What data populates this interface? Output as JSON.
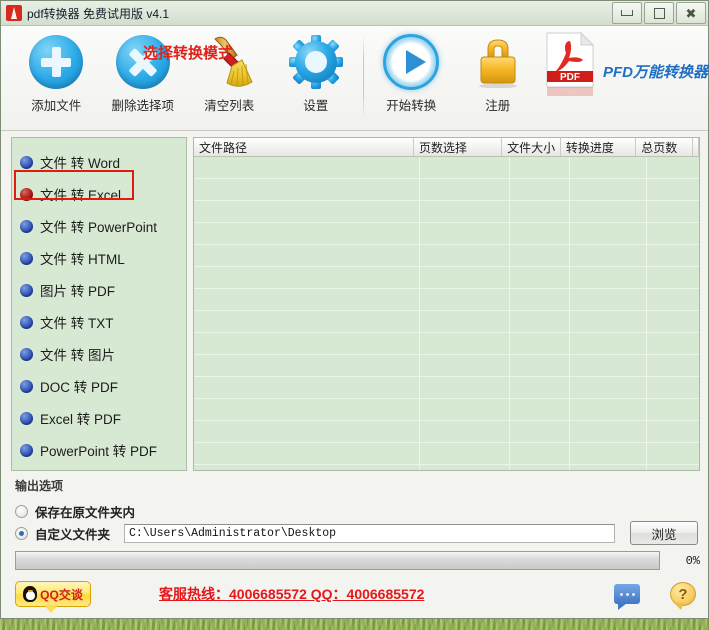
{
  "window": {
    "title": "pdf转换器 免费试用版 v4.1",
    "app_icon": "pdf-app-icon",
    "minimize": "minimize-icon",
    "maximize": "maximize-icon",
    "close": "close-icon"
  },
  "toolbar": {
    "buttons": [
      {
        "label": "添加文件",
        "icon": "add-file-icon"
      },
      {
        "label": "删除选择项",
        "icon": "delete-selection-icon"
      },
      {
        "label": "清空列表",
        "icon": "broom-clear-icon"
      },
      {
        "label": "设置",
        "icon": "gear-settings-icon"
      },
      {
        "label": "开始转换",
        "icon": "play-start-icon"
      },
      {
        "label": "注册",
        "icon": "lock-register-icon"
      }
    ],
    "brand": {
      "icon": "pdf-document-icon",
      "icon_label": "PDF",
      "text": "PFD万能转换器"
    }
  },
  "modes": {
    "items": [
      {
        "label": "文件 转 Word",
        "selected": false
      },
      {
        "label": "文件 转 Excel",
        "selected": true
      },
      {
        "label": "文件 转 PowerPoint",
        "selected": false
      },
      {
        "label": "文件 转 HTML",
        "selected": false
      },
      {
        "label": "图片 转 PDF",
        "selected": false
      },
      {
        "label": "文件 转 TXT",
        "selected": false
      },
      {
        "label": "文件 转 图片",
        "selected": false
      },
      {
        "label": "DOC 转 PDF",
        "selected": false
      },
      {
        "label": "Excel 转 PDF",
        "selected": false
      },
      {
        "label": "PowerPoint 转 PDF",
        "selected": false
      }
    ]
  },
  "annotation": {
    "text": "选择转换模式",
    "color": "#e02218"
  },
  "file_table": {
    "columns": [
      "文件路径",
      "页数选择",
      "文件大小",
      "转换进度",
      "总页数",
      ""
    ],
    "rows": []
  },
  "output_options": {
    "title": "输出选项",
    "same_folder": {
      "label": "保存在原文件夹内",
      "selected": false
    },
    "custom_folder": {
      "label": "自定义文件夹",
      "selected": true
    },
    "path_value": "C:\\Users\\Administrator\\Desktop",
    "browse_label": "浏览"
  },
  "progress": {
    "percent_label": "0%",
    "percent_value": 0
  },
  "footer": {
    "qq_button": "QQ交谈",
    "qq_icon": "qq-penguin-icon",
    "hotline": "客服热线：4006685572 QQ：4006685572",
    "chat_icon": "chat-bubble-icon",
    "help_icon": "help-question-icon",
    "help_glyph": "?"
  },
  "colors": {
    "list_bg": "#d7e9d2",
    "accent_blue": "#2aa9e8",
    "annotation_red": "#e02218",
    "hotline_red": "#e4181b"
  }
}
